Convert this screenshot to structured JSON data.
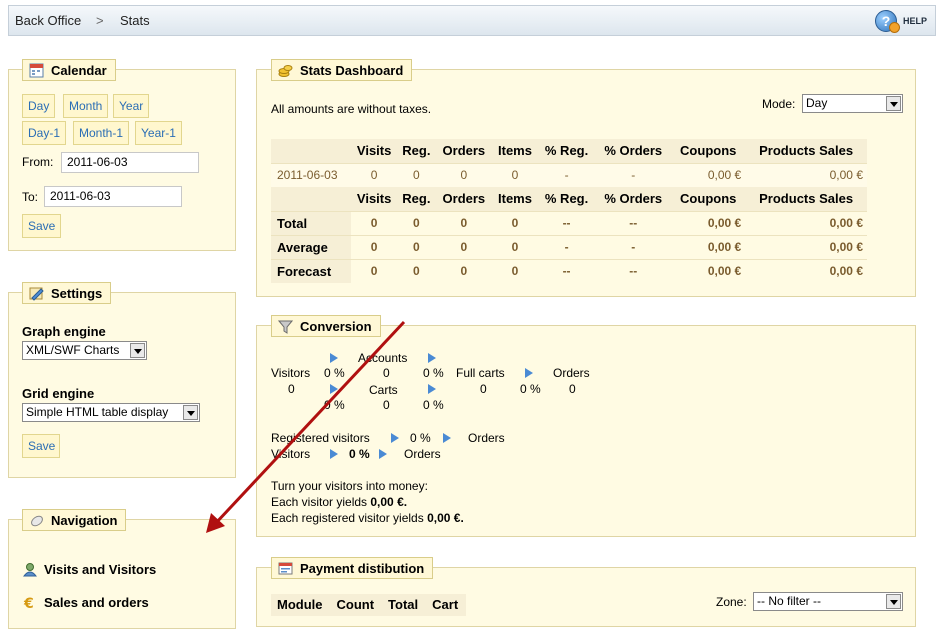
{
  "header": {
    "breadcrumb_home": "Back Office",
    "breadcrumb_sep": ">",
    "breadcrumb_current": "Stats",
    "help_label": "HELP"
  },
  "calendar": {
    "title": "Calendar",
    "buttons_row1": [
      "Day",
      "Month",
      "Year"
    ],
    "buttons_row2": [
      "Day-1",
      "Month-1",
      "Year-1"
    ],
    "from_label": "From:",
    "from_value": "2011-06-03",
    "to_label": "To:",
    "to_value": "2011-06-03",
    "save_label": "Save"
  },
  "settings": {
    "title": "Settings",
    "graph_engine_label": "Graph engine",
    "graph_engine_value": "XML/SWF Charts",
    "grid_engine_label": "Grid engine",
    "grid_engine_value": "Simple HTML table display",
    "save_label": "Save"
  },
  "navigation": {
    "title": "Navigation",
    "items": [
      "Visits and Visitors",
      "Sales and orders"
    ]
  },
  "dashboard": {
    "title": "Stats Dashboard",
    "note": "All amounts are without taxes.",
    "mode_label": "Mode:",
    "mode_value": "Day",
    "columns": [
      "",
      "Visits",
      "Reg.",
      "Orders",
      "Items",
      "% Reg.",
      "% Orders",
      "Coupons",
      "Products Sales"
    ],
    "date_row": [
      "2011-06-03",
      "0",
      "0",
      "0",
      "0",
      "-",
      "-",
      "0,00 €",
      "0,00 €"
    ],
    "summary_rows": [
      [
        "Total",
        "0",
        "0",
        "0",
        "0",
        "--",
        "--",
        "0,00 €",
        "0,00 €"
      ],
      [
        "Average",
        "0",
        "0",
        "0",
        "0",
        "-",
        "-",
        "0,00 €",
        "0,00 €"
      ],
      [
        "Forecast",
        "0",
        "0",
        "0",
        "0",
        "--",
        "--",
        "0,00 €",
        "0,00 €"
      ]
    ]
  },
  "conversion": {
    "title": "Conversion",
    "visitors": "Visitors",
    "visitors_count": "0",
    "pct": "0 %",
    "accounts": "Accounts",
    "accounts_count": "0",
    "carts": "Carts",
    "carts_count": "0",
    "full_carts": "Full carts",
    "full_carts_count": "0",
    "orders": "Orders",
    "orders_count": "0",
    "registered_visitors": "Registered visitors",
    "money_line1": "Turn your visitors into money:",
    "money_line2_prefix": "Each visitor yields ",
    "money_line2_value": "0,00 €.",
    "money_line3_prefix": "Each registered visitor yields ",
    "money_line3_value": "0,00 €."
  },
  "payment": {
    "title": "Payment distibution",
    "zone_label": "Zone:",
    "zone_value": "-- No filter --",
    "columns": [
      "Module",
      "Count",
      "Total",
      "Cart"
    ]
  },
  "colors": {
    "panel_bg": "#fffbe3",
    "panel_border": "#dfd5a5",
    "link_blue": "#2b6eb5",
    "arrow_red": "#b01010"
  }
}
